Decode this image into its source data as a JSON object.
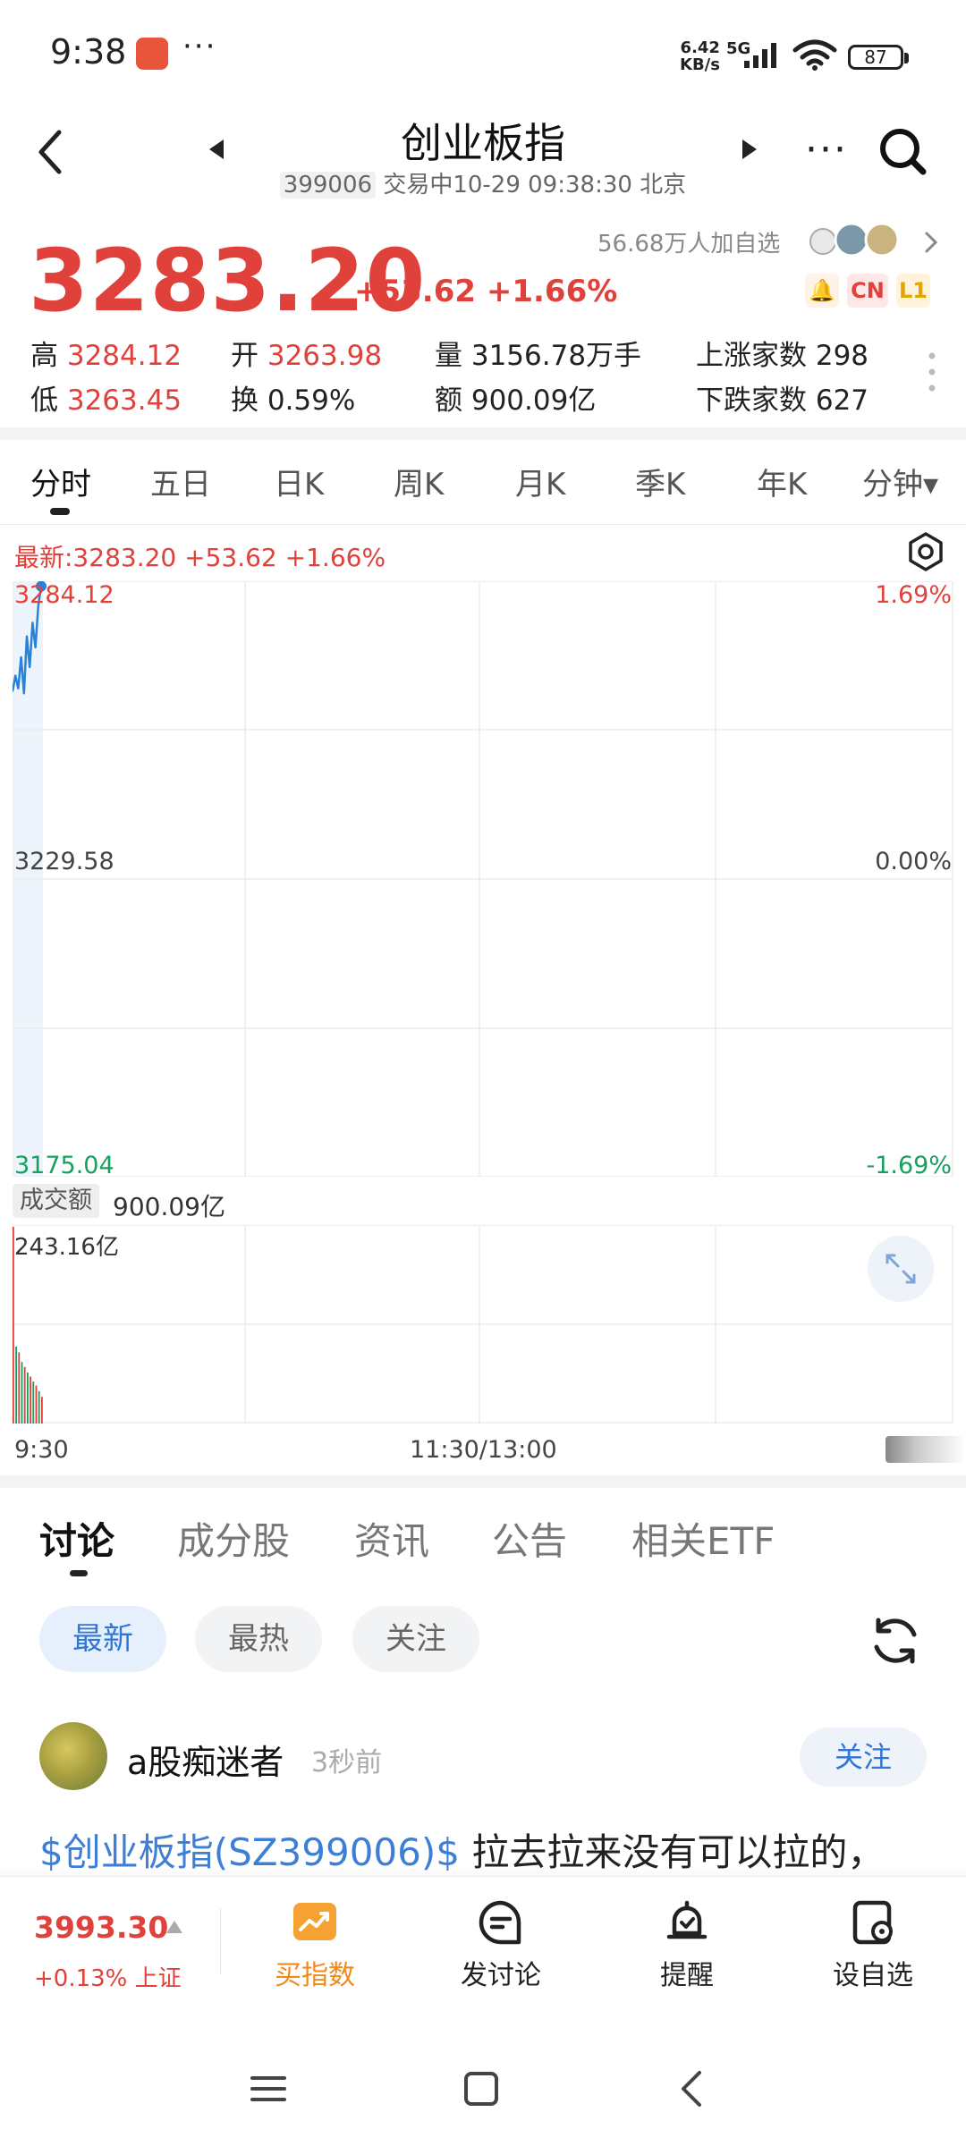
{
  "status_bar": {
    "time": "9:38",
    "more": "···",
    "net_speed_value": "6.42",
    "net_speed_unit": "KB/s",
    "network": "5G",
    "battery": "87"
  },
  "header": {
    "title": "创业板指",
    "code": "399006",
    "status": "交易中10-29 09:38:30 北京"
  },
  "quote": {
    "price": "3283.20",
    "change": "+53.62 +1.66%",
    "followers": "56.68万人加自选",
    "tag_cn": "CN",
    "tag_l1": "L1",
    "stats": {
      "high_label": "高",
      "high_value": "3284.12",
      "open_label": "开",
      "open_value": "3263.98",
      "volume_label": "量",
      "volume_value": "3156.78万手",
      "up_label": "上涨家数",
      "up_value": "298",
      "low_label": "低",
      "low_value": "3263.45",
      "turnover_label": "换",
      "turnover_value": "0.59%",
      "amount_label": "额",
      "amount_value": "900.09亿",
      "down_label": "下跌家数",
      "down_value": "627"
    }
  },
  "chart_tabs": [
    "分时",
    "五日",
    "日K",
    "周K",
    "月K",
    "季K",
    "年K",
    "分钟▾"
  ],
  "chart": {
    "latest": "最新:3283.20  +53.62  +1.66%",
    "y_top": "3284.12",
    "y_mid": "3229.58",
    "y_bot": "3175.04",
    "pct_top": "1.69%",
    "pct_mid": "0.00%",
    "pct_bot": "-1.69%",
    "volume_label": "成交额",
    "volume_total": "900.09亿",
    "volume_max": "243.16亿",
    "time_start": "9:30",
    "time_mid": "11:30/13:00"
  },
  "chart_data": [
    {
      "type": "line",
      "ylim": [
        3175.04,
        3284.12
      ],
      "y_ticks": [
        "3284.12",
        "3229.58",
        "3175.04"
      ],
      "y2_ticks": [
        "1.69%",
        "0.00%",
        "-1.69%"
      ],
      "x_ticks": [
        "9:30",
        "11:30/13:00"
      ],
      "series": [
        {
          "values": [
            3263.9,
            3266.8,
            3264.5,
            3270.2,
            3263.6,
            3274.0,
            3268.4,
            3276.5,
            3272.0,
            3279.6,
            3283.2
          ]
        }
      ]
    },
    {
      "type": "bar",
      "ylim": [
        0,
        243.16
      ],
      "series": [
        {
          "values": [
            243.16,
            95,
            88,
            76,
            70,
            63,
            58,
            52,
            47,
            40,
            33
          ]
        }
      ]
    }
  ],
  "content_tabs": [
    "讨论",
    "成分股",
    "资讯",
    "公告",
    "相关ETF"
  ],
  "filters": [
    "最新",
    "最热",
    "关注"
  ],
  "post": {
    "user": "a股痴迷者",
    "time": "3秒前",
    "follow": "关注",
    "tag": "$创业板指(SZ399006)$",
    "text": " 拉去拉来没有可以拉的，"
  },
  "bottom_bar": {
    "sh_price": "3993.30",
    "sh_change": "+0.13% 上证",
    "items": [
      "买指数",
      "发讨论",
      "提醒",
      "设自选"
    ]
  },
  "colors": {
    "up_red": "#e0413b",
    "down_green": "#18a060",
    "accent_blue": "#2f76d6",
    "accent_orange": "#f08a1a"
  }
}
